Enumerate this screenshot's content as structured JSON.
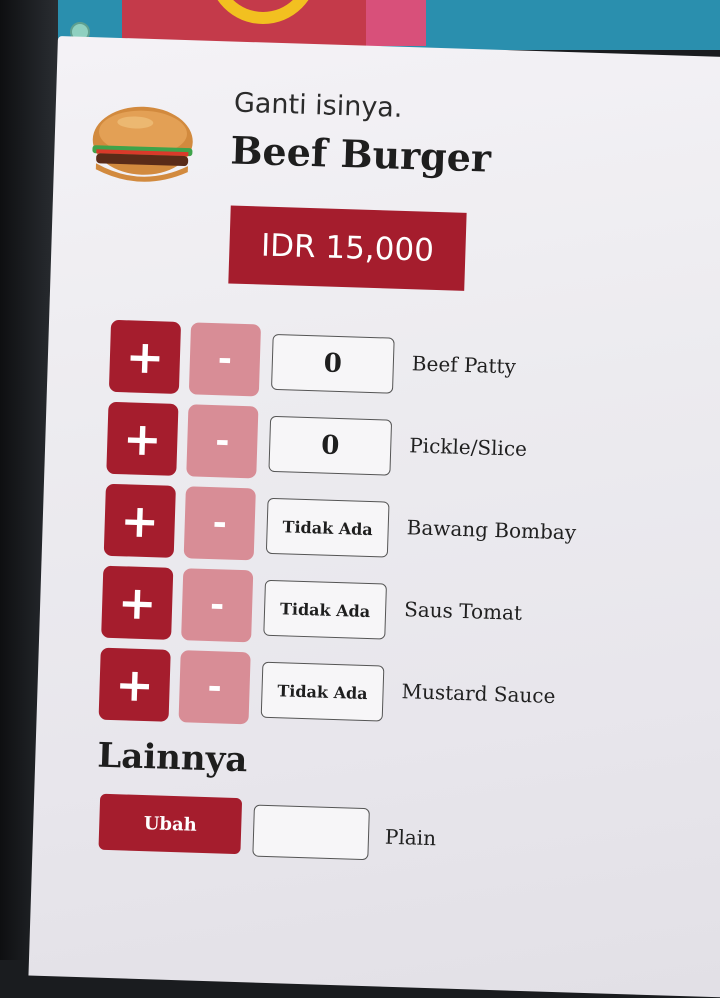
{
  "header": {
    "subtitle": "Ganti isinya.",
    "title": "Beef Burger",
    "price": "IDR 15,000"
  },
  "buttons": {
    "plus_symbol": "+",
    "minus_symbol": "-"
  },
  "ingredients": [
    {
      "name": "Beef Patty",
      "value": "0"
    },
    {
      "name": "Pickle/Slice",
      "value": "0"
    },
    {
      "name": "Bawang Bombay",
      "value": "Tidak Ada"
    },
    {
      "name": "Saus Tomat",
      "value": "Tidak Ada"
    },
    {
      "name": "Mustard Sauce",
      "value": "Tidak Ada"
    }
  ],
  "others": {
    "section_title": "Lainnya",
    "change_label": "Ubah",
    "value": "",
    "option_label": "Plain"
  },
  "colors": {
    "accent": "#a51d2d",
    "minus_button": "#d88d96",
    "background": "#ecebef"
  }
}
